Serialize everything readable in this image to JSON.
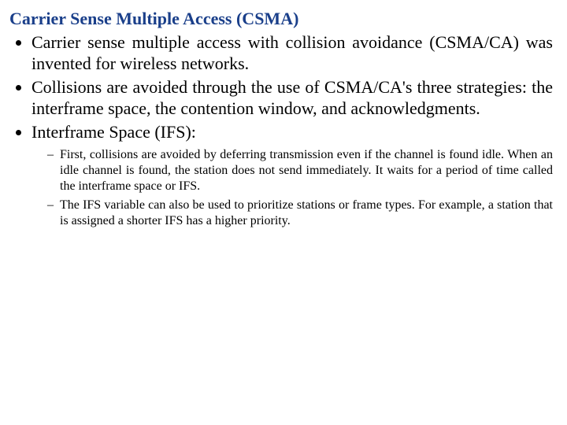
{
  "title": "Carrier Sense Multiple Access (CSMA)",
  "bullets": {
    "b1": "Carrier sense multiple access with collision avoidance (CSMA/CA) was invented for wireless networks.",
    "b2": "Collisions are avoided through the use of CSMA/CA's three strategies: the interframe space, the contention window, and acknowledgments.",
    "b3": "Interframe Space (IFS):"
  },
  "sub": {
    "s1": "First, collisions are avoided by deferring transmission even if the channel is found idle. When an idle channel is found, the station does not send immediately. It waits for a period of time called the interframe space or IFS.",
    "s2": "The IFS variable can also be used to prioritize stations or frame types. For example, a station that is assigned a shorter IFS has a higher priority."
  }
}
